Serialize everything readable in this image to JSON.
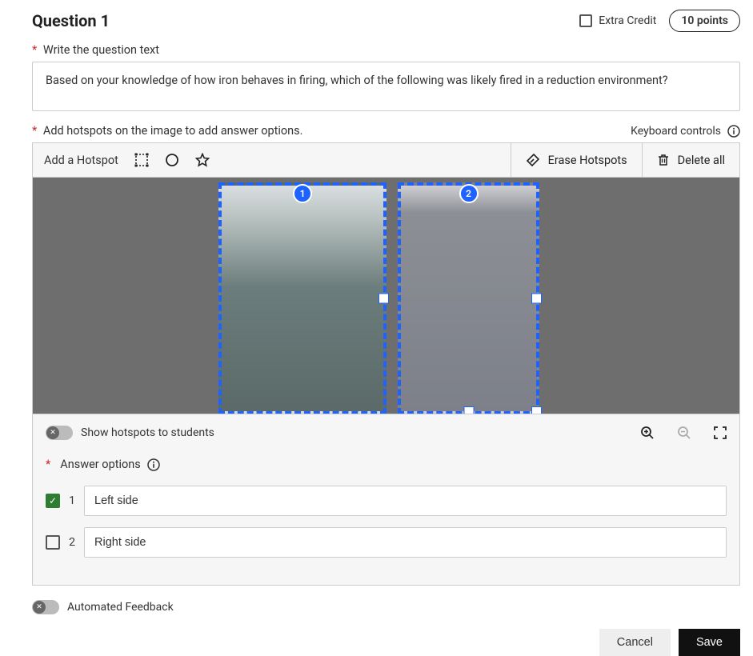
{
  "header": {
    "question_title": "Question 1",
    "extra_credit_label": "Extra Credit",
    "extra_credit_checked": false,
    "points_label": "10 points"
  },
  "question_text": {
    "label": "Write the question text",
    "value": "Based on your knowledge of how iron behaves in firing, which of the following was likely fired in a reduction environment?"
  },
  "hotspot_section": {
    "instruction": "Add hotspots on the image to add answer options.",
    "keyboard_controls_label": "Keyboard controls"
  },
  "toolbar": {
    "add_label": "Add a Hotspot",
    "erase_label": "Erase Hotspots",
    "delete_label": "Delete all"
  },
  "hotspots": [
    {
      "number": "1"
    },
    {
      "number": "2"
    }
  ],
  "panel": {
    "show_hotspots_label": "Show hotspots to students",
    "show_hotspots_on": false,
    "answer_options_label": "Answer options"
  },
  "answer_options": [
    {
      "number": "1",
      "label": "Left side",
      "checked": true
    },
    {
      "number": "2",
      "label": "Right side",
      "checked": false
    }
  ],
  "automated_feedback": {
    "label": "Automated Feedback",
    "on": false
  },
  "footer": {
    "cancel": "Cancel",
    "save": "Save"
  }
}
